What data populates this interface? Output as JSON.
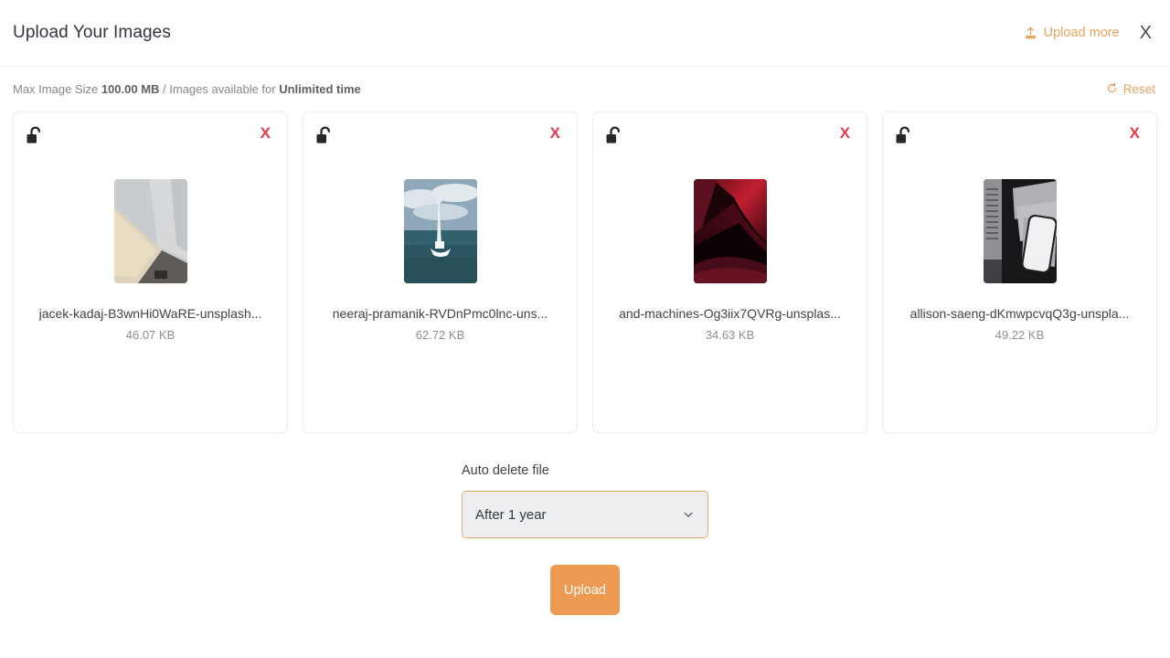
{
  "header": {
    "title": "Upload Your Images",
    "upload_more_label": "Upload more",
    "upload_more_icon": "upload-icon",
    "close_label": "X",
    "accent_color": "#e8a35c"
  },
  "infobar": {
    "prefix": "Max Image Size ",
    "max_size": "100.00 MB",
    "middle": " / Images available for ",
    "availability": "Unlimited time",
    "reset_label": "Reset",
    "reset_icon": "refresh-icon"
  },
  "cards": [
    {
      "lock_icon": "unlock-icon",
      "remove_label": "X",
      "file_name": "jacek-kadaj-B3wnHi0WaRE-unsplash...",
      "file_size": "46.07 KB",
      "thumb": "architecture-beige-grey"
    },
    {
      "lock_icon": "unlock-icon",
      "remove_label": "X",
      "file_name": "neeraj-pramanik-RVDnPmc0lnc-uns...",
      "file_size": "62.72 KB",
      "thumb": "sailboat-ocean"
    },
    {
      "lock_icon": "unlock-icon",
      "remove_label": "X",
      "file_name": "and-machines-Og3iix7QVRg-unsplas...",
      "file_size": "34.63 KB",
      "thumb": "abstract-red-black"
    },
    {
      "lock_icon": "unlock-icon",
      "remove_label": "X",
      "file_name": "allison-saeng-dKmwpcvqQ3g-unspla...",
      "file_size": "49.22 KB",
      "thumb": "phone-greyscale"
    }
  ],
  "form": {
    "auto_delete_label": "Auto delete file",
    "auto_delete_value": "After 1 year",
    "chevron_icon": "chevron-down-icon",
    "upload_button_label": "Upload",
    "upload_button_color": "#ed9a52",
    "select_border_color": "#e6a765"
  }
}
